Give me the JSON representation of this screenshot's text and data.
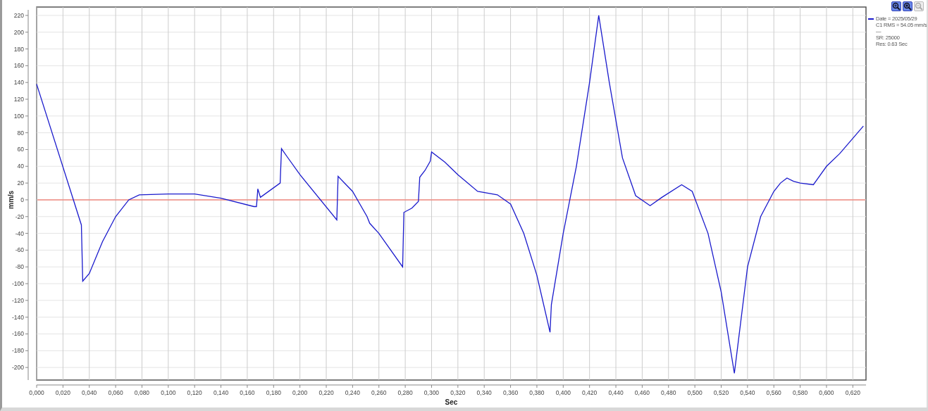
{
  "toolbar": [
    {
      "kind": "zoom-in",
      "disabled": false
    },
    {
      "kind": "zoom-area",
      "disabled": false
    },
    {
      "kind": "zoom-out",
      "disabled": true
    }
  ],
  "legend": {
    "details": [
      "C1 RMS = 54.05 mm/s",
      "—",
      "SR: 25000",
      "Res: 0.63 Sec"
    ]
  },
  "chart_data": {
    "type": "line",
    "xlabel": "Sec",
    "ylabel": "mm/s",
    "xlim": [
      0,
      0.63
    ],
    "ylim": [
      -215,
      230
    ],
    "x": [
      0,
      0.034,
      0.035,
      0.04,
      0.05,
      0.06,
      0.07,
      0.078,
      0.1,
      0.12,
      0.14,
      0.165,
      0.167,
      0.168,
      0.17,
      0.185,
      0.186,
      0.19,
      0.2,
      0.228,
      0.229,
      0.24,
      0.251,
      0.253,
      0.26,
      0.278,
      0.279,
      0.285,
      0.29,
      0.291,
      0.295,
      0.299,
      0.3,
      0.31,
      0.32,
      0.335,
      0.35,
      0.36,
      0.37,
      0.38,
      0.39,
      0.391,
      0.4,
      0.41,
      0.42,
      0.427,
      0.435,
      0.445,
      0.455,
      0.466,
      0.475,
      0.49,
      0.498,
      0.51,
      0.52,
      0.53,
      0.54,
      0.55,
      0.56,
      0.565,
      0.57,
      0.575,
      0.58,
      0.59,
      0.6,
      0.61,
      0.628
    ],
    "series": [
      {
        "name": "Date = 2025/05/29",
        "color": "#1a1acc",
        "values": [
          138,
          -30,
          -97,
          -88,
          -50,
          -20,
          0,
          6,
          7,
          7,
          2,
          -8,
          -8,
          13,
          3,
          20,
          61,
          52,
          30,
          -24,
          28,
          10,
          -20,
          -28,
          -40,
          -80,
          -15,
          -10,
          -2,
          27,
          35,
          46,
          57,
          45,
          30,
          10,
          6,
          -5,
          -40,
          -90,
          -158,
          -125,
          -40,
          40,
          140,
          220,
          140,
          50,
          5,
          -7,
          3,
          18,
          10,
          -40,
          -110,
          -207,
          -80,
          -20,
          10,
          20,
          26,
          22,
          20,
          18,
          40,
          55,
          88
        ]
      }
    ],
    "yticks": [
      -200,
      -180,
      -160,
      -140,
      -120,
      -100,
      -80,
      -60,
      -40,
      -20,
      0,
      20,
      40,
      60,
      80,
      100,
      120,
      140,
      160,
      180,
      200,
      220
    ],
    "xticks": [
      {
        "value": 0,
        "label": "0,000"
      },
      {
        "value": 0.02,
        "label": "0,020"
      },
      {
        "value": 0.04,
        "label": "0,040"
      },
      {
        "value": 0.06,
        "label": "0,060"
      },
      {
        "value": 0.08,
        "label": "0,080"
      },
      {
        "value": 0.1,
        "label": "0,100"
      },
      {
        "value": 0.12,
        "label": "0,120"
      },
      {
        "value": 0.14,
        "label": "0,140"
      },
      {
        "value": 0.16,
        "label": "0,160"
      },
      {
        "value": 0.18,
        "label": "0,180"
      },
      {
        "value": 0.2,
        "label": "0,200"
      },
      {
        "value": 0.22,
        "label": "0,220"
      },
      {
        "value": 0.24,
        "label": "0,240"
      },
      {
        "value": 0.26,
        "label": "0,260"
      },
      {
        "value": 0.28,
        "label": "0,280"
      },
      {
        "value": 0.3,
        "label": "0,300"
      },
      {
        "value": 0.32,
        "label": "0,320"
      },
      {
        "value": 0.34,
        "label": "0,340"
      },
      {
        "value": 0.36,
        "label": "0,360"
      },
      {
        "value": 0.38,
        "label": "0,380"
      },
      {
        "value": 0.4,
        "label": "0,400"
      },
      {
        "value": 0.42,
        "label": "0,420"
      },
      {
        "value": 0.44,
        "label": "0,440"
      },
      {
        "value": 0.46,
        "label": "0,460"
      },
      {
        "value": 0.48,
        "label": "0,480"
      },
      {
        "value": 0.5,
        "label": "0,500"
      },
      {
        "value": 0.52,
        "label": "0,520"
      },
      {
        "value": 0.54,
        "label": "0,540"
      },
      {
        "value": 0.56,
        "label": "0,560"
      },
      {
        "value": 0.58,
        "label": "0,580"
      },
      {
        "value": 0.6,
        "label": "0,600"
      },
      {
        "value": 0.62,
        "label": "0,620"
      }
    ],
    "grid": true,
    "ref_lines": [
      {
        "axis": "y",
        "value": 0,
        "color": "#f08a80"
      }
    ]
  }
}
